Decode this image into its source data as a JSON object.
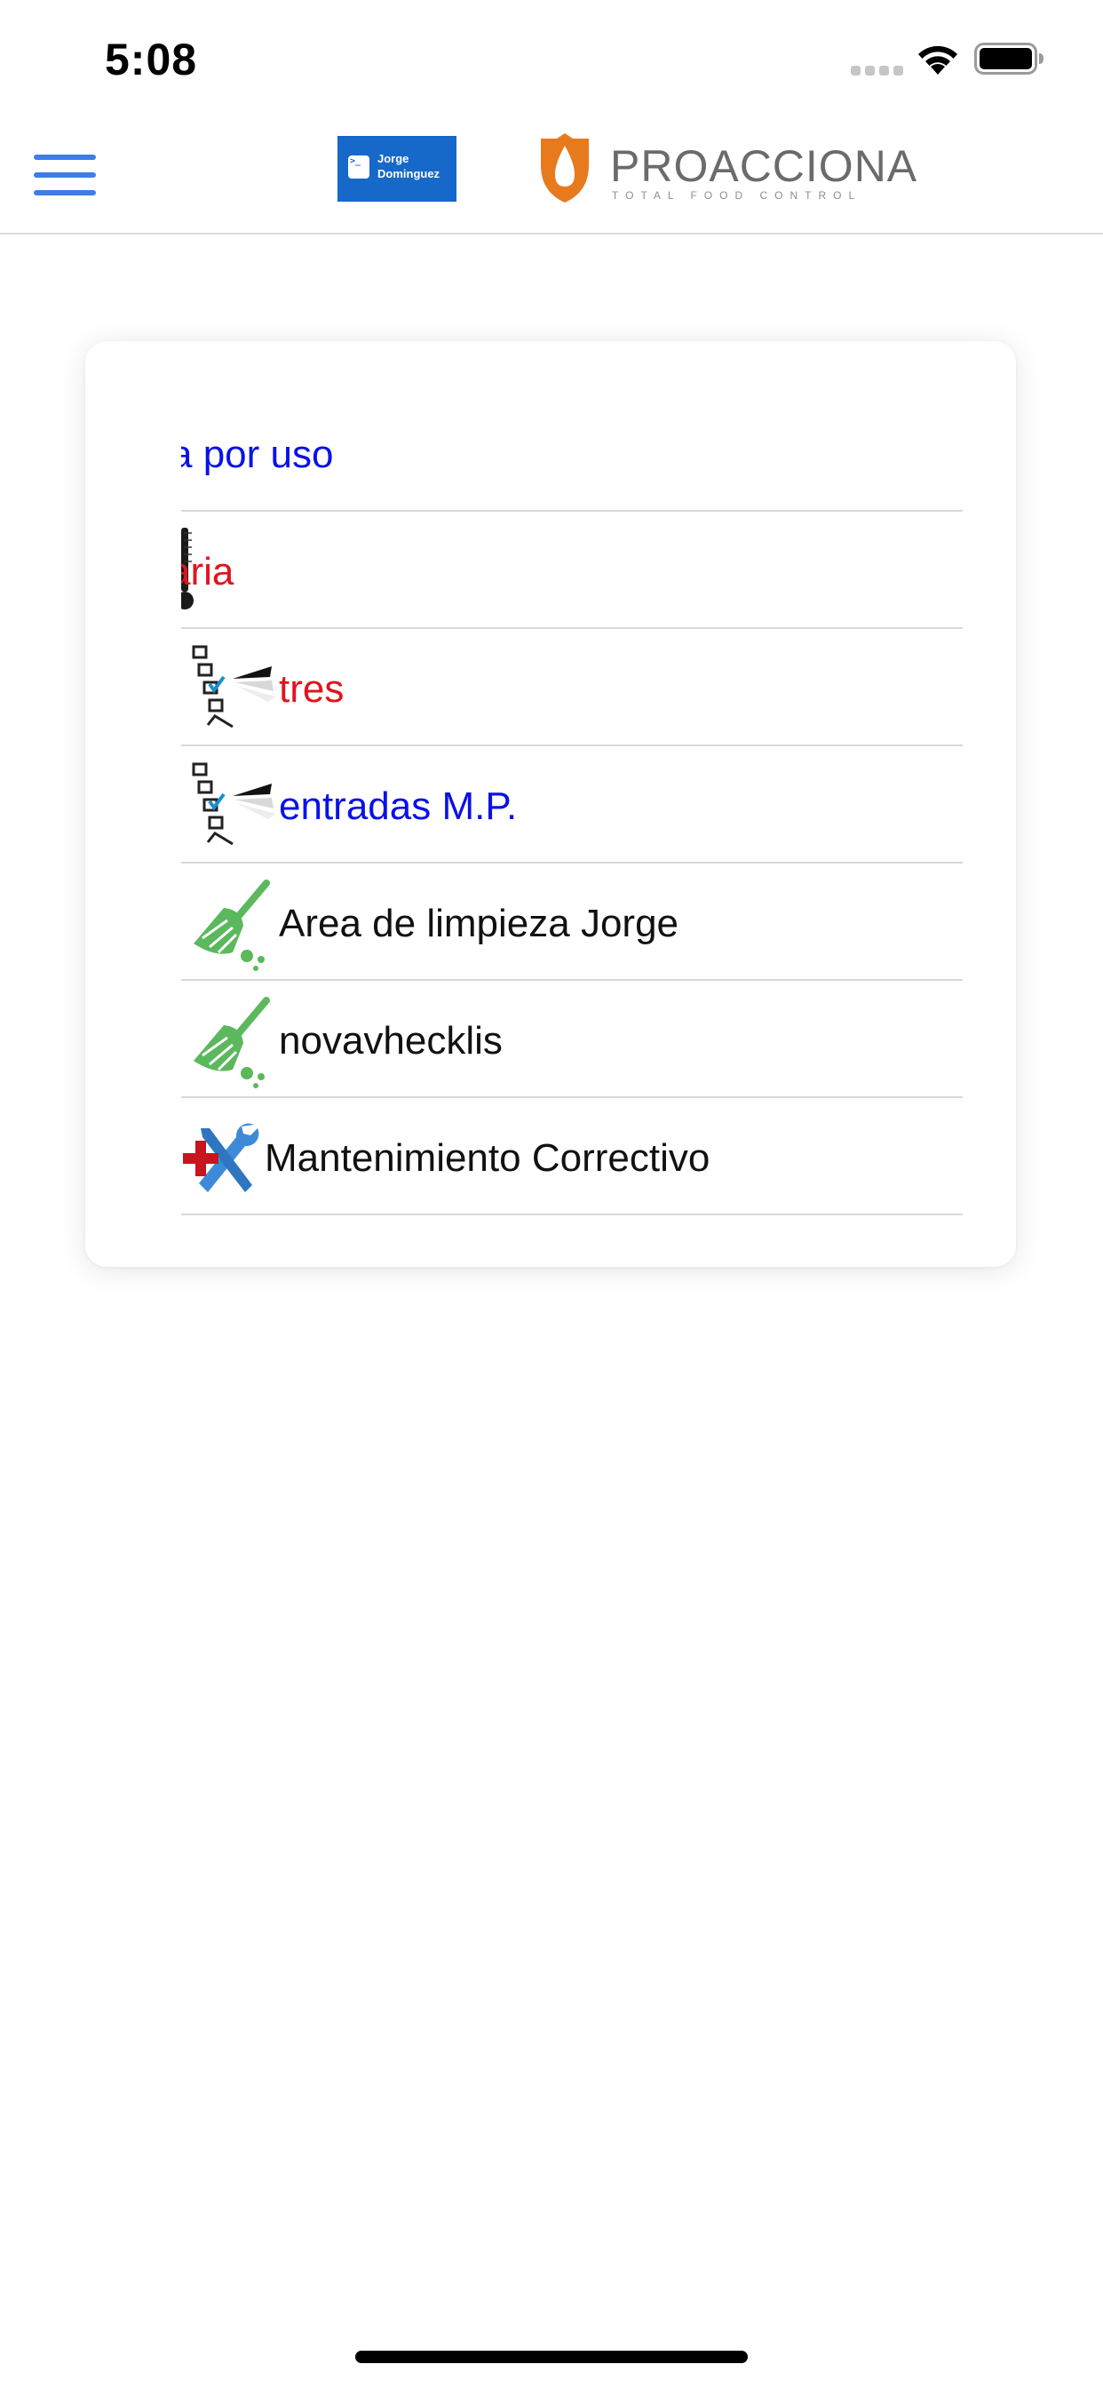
{
  "status_bar": {
    "time": "5:08"
  },
  "header": {
    "user_badge": {
      "terminal_glyph": ">_",
      "name": "Jorge Dominguez"
    },
    "brand": {
      "name": "PROACCIONA",
      "tagline": "TOTAL FOOD CONTROL"
    }
  },
  "colors": {
    "accent_blue": "#3d7ee6",
    "badge_blue": "#1668c9",
    "brand_orange": "#e87a1e",
    "link_blue": "#0a12e6",
    "alert_red": "#e0141e",
    "broom_green": "#5cb85c"
  },
  "list": {
    "items": [
      {
        "label": "a por uso",
        "color": "blue",
        "icon": "none"
      },
      {
        "label": "aria",
        "color": "red",
        "icon": "thermometer-icon"
      },
      {
        "label": "tres",
        "color": "red",
        "icon": "checklist-icon"
      },
      {
        "label": "entradas M.P.",
        "color": "blue",
        "icon": "checklist-icon"
      },
      {
        "label": "Area de limpieza Jorge",
        "color": "black",
        "icon": "broom-icon"
      },
      {
        "label": "novavhecklis",
        "color": "black",
        "icon": "broom-icon"
      },
      {
        "label": "Mantenimiento Correctivo",
        "color": "black",
        "icon": "maintenance-tools-icon"
      }
    ]
  }
}
